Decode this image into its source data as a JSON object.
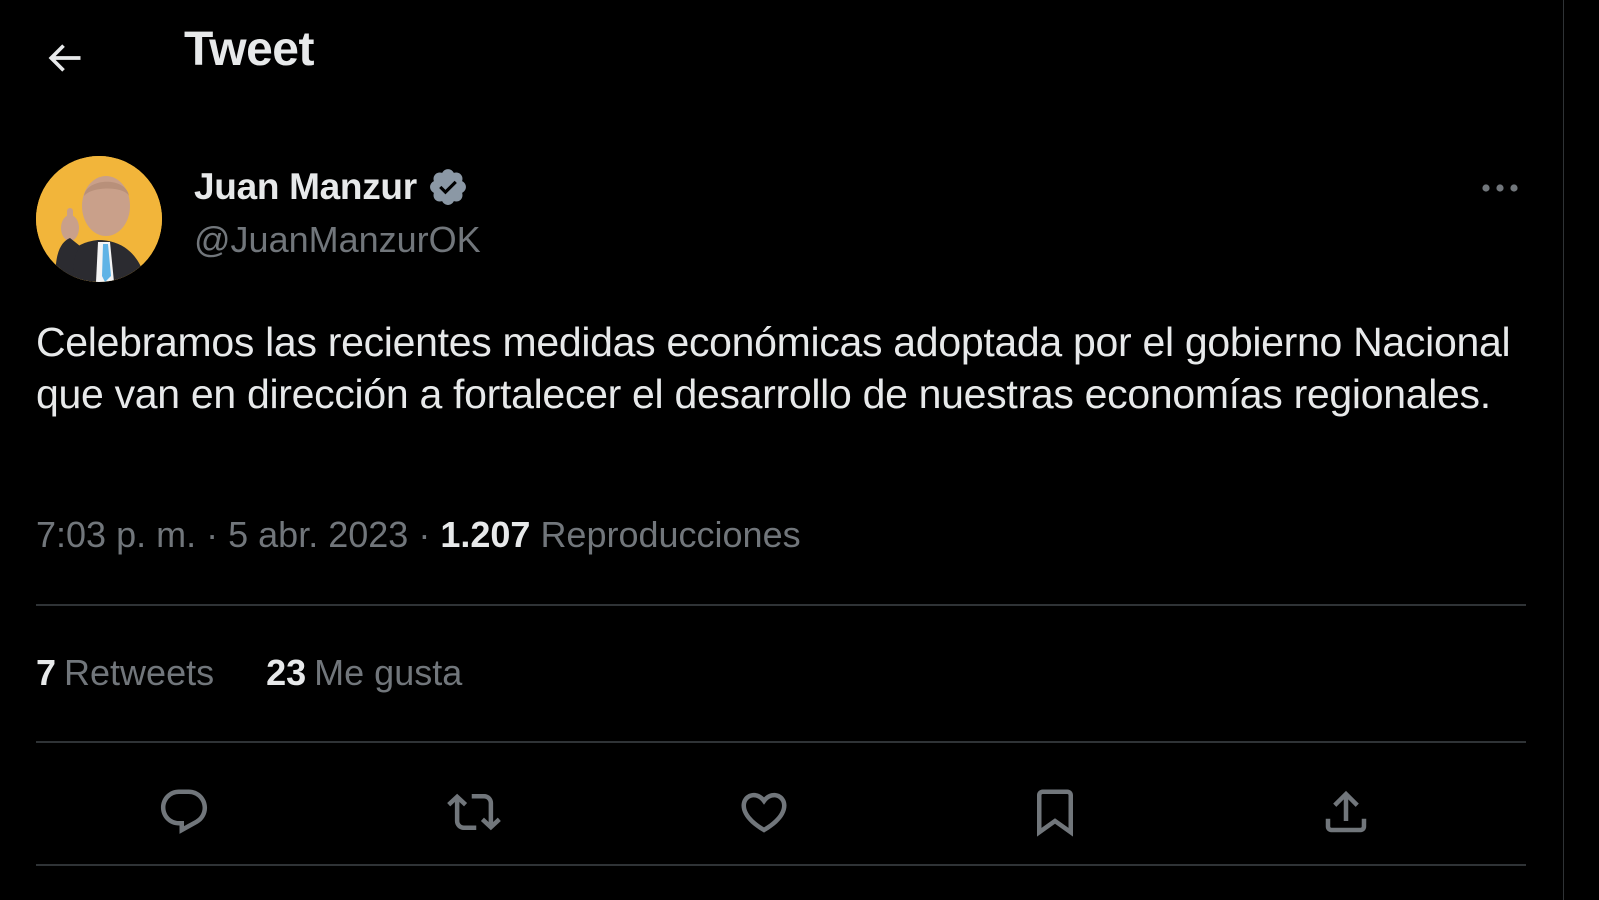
{
  "header": {
    "title": "Tweet",
    "back_icon": "arrow-left-icon"
  },
  "author": {
    "name": "Juan Manzur",
    "handle": "@JuanManzurOK",
    "verified": true,
    "avatar_bg": "#f2b53a"
  },
  "tweet": {
    "text": "Celebramos las recientes medidas económicas adoptada por el gobierno Nacional que van en dirección a fortalecer el desarrollo de nuestras economías regionales."
  },
  "meta": {
    "time": "7:03 p. m.",
    "separator": "·",
    "date": "5 abr. 2023",
    "views_count": "1.207",
    "views_label": "Reproducciones"
  },
  "stats": {
    "retweets_count": "7",
    "retweets_label": "Retweets",
    "likes_count": "23",
    "likes_label": "Me gusta"
  },
  "actions": [
    "reply-icon",
    "retweet-icon",
    "like-icon",
    "bookmark-icon",
    "share-icon"
  ],
  "colors": {
    "background": "#000000",
    "text_primary": "#e7e9ea",
    "text_secondary": "#71767b",
    "divider": "#2f3336",
    "verified_badge": "#8b98a5"
  }
}
